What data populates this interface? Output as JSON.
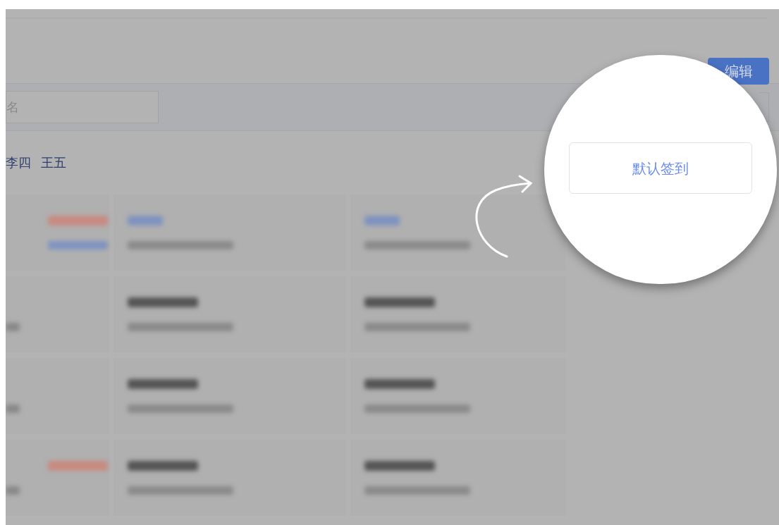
{
  "header": {
    "edit_button": "编辑"
  },
  "search": {
    "placeholder": "名"
  },
  "name_list": [
    "李四",
    "王五"
  ],
  "spotlight": {
    "button": "默认签到"
  }
}
